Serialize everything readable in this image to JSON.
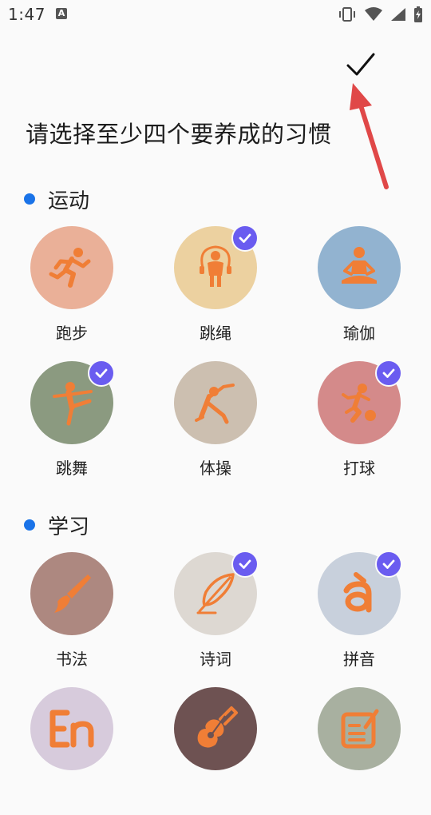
{
  "status_bar": {
    "time": "1:47",
    "notification_icon": "A"
  },
  "header": {
    "confirm_icon": "checkmark-icon",
    "title": "请选择至少四个要养成的习惯"
  },
  "colors": {
    "accent": "#6a5cf0",
    "section_dot": "#1a73e8",
    "icon_orange": "#f07e36",
    "annotation_arrow": "#e04848"
  },
  "sections": [
    {
      "title": "运动",
      "items": [
        {
          "label": "跑步",
          "icon": "running-icon",
          "color": "#eab098",
          "selected": false
        },
        {
          "label": "跳绳",
          "icon": "jump-rope-icon",
          "color": "#ecd1a0",
          "selected": true
        },
        {
          "label": "瑜伽",
          "icon": "yoga-icon",
          "color": "#92b3d0",
          "selected": false
        },
        {
          "label": "跳舞",
          "icon": "dance-icon",
          "color": "#8b9a80",
          "selected": true
        },
        {
          "label": "体操",
          "icon": "gymnastics-icon",
          "color": "#ccbfb0",
          "selected": false
        },
        {
          "label": "打球",
          "icon": "ball-sport-icon",
          "color": "#d48a8a",
          "selected": true
        }
      ]
    },
    {
      "title": "学习",
      "items": [
        {
          "label": "书法",
          "icon": "calligraphy-brush-icon",
          "color": "#ad8880",
          "selected": false
        },
        {
          "label": "诗词",
          "icon": "feather-quill-icon",
          "color": "#ddd8d2",
          "selected": true
        },
        {
          "label": "拼音",
          "icon": "pinyin-a-icon",
          "color": "#c8d0dc",
          "selected": true
        },
        {
          "label": "",
          "icon": "english-en-icon",
          "color": "#d7cbdc",
          "selected": false
        },
        {
          "label": "",
          "icon": "guitar-icon",
          "color": "#6e5252",
          "selected": false
        },
        {
          "label": "",
          "icon": "note-edit-icon",
          "color": "#a8b0a0",
          "selected": false
        }
      ]
    }
  ]
}
